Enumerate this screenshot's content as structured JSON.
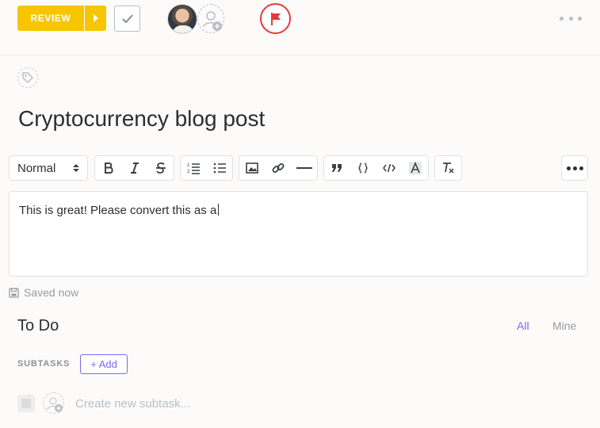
{
  "header": {
    "status_label": "REVIEW",
    "colors": {
      "status": "#f7c600",
      "flag": "#e8383d",
      "accent": "#7b68ee"
    },
    "icons": [
      "caret-right-icon",
      "checkmark-icon",
      "user-add-icon",
      "flag-icon",
      "more-horizontal-icon"
    ]
  },
  "task": {
    "title": "Cryptocurrency blog post",
    "tag_icon": "tag-icon"
  },
  "toolbar": {
    "text_style": "Normal",
    "icons": [
      "bold-icon",
      "italic-icon",
      "strikethrough-icon",
      "ordered-list-icon",
      "bullet-list-icon",
      "image-icon",
      "link-icon",
      "horizontal-rule-icon",
      "quote-icon",
      "code-block-icon",
      "inline-code-icon",
      "highlight-icon",
      "clear-format-icon",
      "more-horizontal-icon"
    ]
  },
  "comment": {
    "text": "This is great! Please convert this as a",
    "status": "Saved now"
  },
  "checklist": {
    "title": "To Do",
    "filter_all": "All",
    "filter_mine": "Mine"
  },
  "subtasks": {
    "label": "SUBTASKS",
    "add_label": "+ Add",
    "placeholder": "Create new subtask..."
  }
}
